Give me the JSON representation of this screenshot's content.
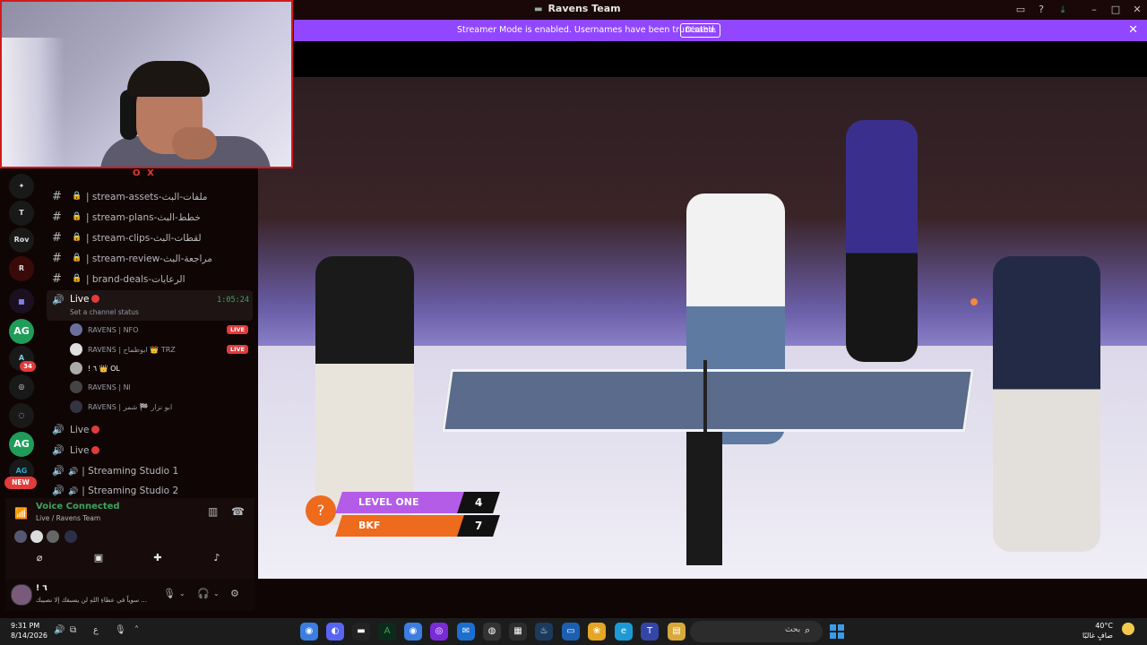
{
  "window": {
    "title": "Ravens Team",
    "controls": [
      "inbox-icon",
      "help-icon",
      "download-icon",
      "minimize-icon",
      "maximize-icon",
      "close-icon"
    ]
  },
  "banner": {
    "text": "Streamer Mode is enabled. Usernames have been truncated.",
    "button": "Disable"
  },
  "webcam": {
    "overlay_label": "OX"
  },
  "servers": [
    {
      "label": "✦",
      "style": "dark"
    },
    {
      "label": "T",
      "style": "dark"
    },
    {
      "label": "Rov",
      "style": "dark"
    },
    {
      "label": "R",
      "style": "dark"
    },
    {
      "label": "▪",
      "style": "folder"
    },
    {
      "label": "AG",
      "style": "green"
    },
    {
      "label": "A",
      "style": "dark",
      "badge": "34"
    },
    {
      "label": "◎",
      "style": "dark"
    },
    {
      "label": "◌",
      "style": "dark"
    },
    {
      "label": "AG",
      "style": "green"
    },
    {
      "label": "AG",
      "style": "dark"
    }
  ],
  "server_new_badge": "NEW",
  "text_channels": [
    {
      "name": "| stream-assets-",
      "arabic": "ملفات-البث"
    },
    {
      "name": "| stream-plans-",
      "arabic": "خطط-البث"
    },
    {
      "name": "| stream-clips-",
      "arabic": "لقطات-البث"
    },
    {
      "name": "| stream-review-",
      "arabic": "مراجعة-البث"
    },
    {
      "name": "| brand-deals-",
      "arabic": "الرعايات"
    }
  ],
  "active_voice_channel": {
    "label": "Live",
    "status": "Set a channel status",
    "timer": "1:05:24"
  },
  "voice_users": [
    {
      "name": "RAVENS | NFO",
      "live": "LIVE"
    },
    {
      "name": "RAVENS | ابوطماح 👑 TRZ",
      "live": "LIVE"
    },
    {
      "name": "! ٦ 👑 OL",
      "live": ""
    },
    {
      "name": "RAVENS | Nl",
      "live": ""
    },
    {
      "name": "RAVENS | ابو نزار 🏁 شمر",
      "live": ""
    }
  ],
  "voice_channels": [
    {
      "name": "Live",
      "live_dot": true
    },
    {
      "name": "Live",
      "live_dot": true
    },
    {
      "name": "| Streaming Studio 1",
      "live_dot": false
    },
    {
      "name": "| Streaming Studio 2",
      "live_dot": false
    }
  ],
  "voice_panel": {
    "title": "Voice Connected",
    "subtitle": "Live / Ravens Team",
    "actions": [
      "camera-off-icon",
      "screen-share-icon",
      "activities-icon",
      "soundboard-icon"
    ]
  },
  "user_bar": {
    "name": "! ٦",
    "status": "سوياً في عطاءِ اللهِ لن يسبقك إلا نصيبك ..."
  },
  "scoreboard": {
    "teams": [
      {
        "name": "LEVEL ONE",
        "score": "4",
        "color": "#b45ce8"
      },
      {
        "name": "BKF",
        "score": "7",
        "color": "#ee6a1d"
      }
    ]
  },
  "taskbar": {
    "time": "9:31 PM",
    "date": "8/14/2026",
    "lang": "ع",
    "search_placeholder": "بحث",
    "weather_temp": "40°C",
    "weather_desc": "صافٍ غالبًا",
    "apps": [
      "chrome-icon",
      "discord-icon",
      "terminal-icon",
      "app-a-icon",
      "chrome-profile-icon",
      "obs-icon",
      "mail-icon",
      "obs-studio-icon",
      "store-icon",
      "steam-icon",
      "screen-icon",
      "photos-icon",
      "edge-icon",
      "teams-icon",
      "file-explorer-icon"
    ]
  }
}
